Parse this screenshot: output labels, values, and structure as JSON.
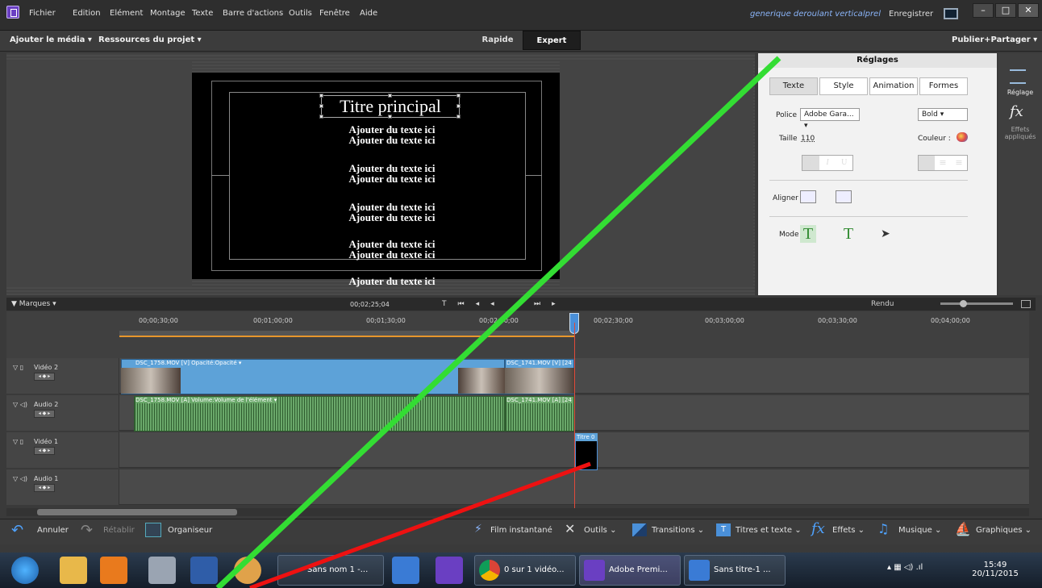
{
  "menubar": {
    "items": [
      "Fichier",
      "Edition",
      "Elément",
      "Montage",
      "Texte",
      "Barre d'actions",
      "Outils",
      "Fenêtre",
      "Aide"
    ],
    "project_name": "generique deroulant verticalprel",
    "save_label": "Enregistrer",
    "min": "–",
    "restore": "□",
    "close": "✕"
  },
  "toolbar": {
    "add_media": "Ajouter le média ▾",
    "project_assets": "Ressources du projet ▾",
    "rapide": "Rapide",
    "expert": "Expert",
    "publish": "Publier+Partager ▾"
  },
  "stage": {
    "title": "Titre principal",
    "lines": [
      "Ajouter du texte ici",
      "Ajouter du texte ici",
      "Ajouter du texte ici",
      "Ajouter du texte ici",
      "Ajouter du texte ici",
      "Ajouter du texte ici",
      "Ajouter du texte ici",
      "Ajouter du texte ici",
      "Ajouter du texte ici"
    ]
  },
  "panel": {
    "header": "Réglages",
    "tabs": [
      "Texte",
      "Style",
      "Animation",
      "Formes"
    ],
    "police_label": "Police",
    "police_value": "Adobe Gara... ▾",
    "weight_value": "Bold  ▾",
    "taille_label": "Taille",
    "taille_value": "110",
    "couleur_label": "Couleur :",
    "bold": "B",
    "italic": "I",
    "underline": "U",
    "aligner_label": "Aligner",
    "mode_label": "Mode"
  },
  "rightside": {
    "reglage": "Réglage",
    "effets": "Effets appliqués"
  },
  "timeline": {
    "marques": "▼ Marques  ▾",
    "timecode": "00;02;25;04",
    "rendu": "Rendu",
    "ticks": [
      "00;00;30;00",
      "00;01;00;00",
      "00;01;30;00",
      "00;02;00;00",
      "00;02;30;00",
      "00;03;00;00",
      "00;03;30;00",
      "00;04;00;00"
    ],
    "tracks": [
      "Vidéo 2",
      "Audio 2",
      "Vidéo 1",
      "Audio 1"
    ],
    "clips": {
      "v2a": "DSC_1758.MOV [V]  Opacité:Opacité ▾",
      "v2b": "DSC_1741.MOV [V] [24",
      "a2a": "DSC_1758.MOV [A]  Volume:Volume de l'élément ▾",
      "a2b": "DSC_1741.MOV [A] [24",
      "title": "Titre 0"
    }
  },
  "bottombar": {
    "annuler": "Annuler",
    "retablir": "Rétablir",
    "organiseur": "Organiseur",
    "film": "Film instantané",
    "outils": "Outils  ⌄",
    "transitions": "Transitions  ⌄",
    "titres": "Titres et texte  ⌄",
    "effets": "Effets  ⌄",
    "musique": "Musique  ⌄",
    "graphiques": "Graphiques  ⌄"
  },
  "taskbar": {
    "btn1": "Sans nom 1 -...",
    "btn2": "0 sur 1 vidéo...",
    "btn3": "Adobe Premi...",
    "btn4": "Sans titre-1 ...",
    "time": "15:49",
    "date": "20/11/2015"
  },
  "colors": {
    "green_line": "#33dd33",
    "red_line": "#ee1111",
    "video_clip": "#5da2d8",
    "audio_clip": "#6aa86a",
    "accent": "#6a3fc2"
  }
}
